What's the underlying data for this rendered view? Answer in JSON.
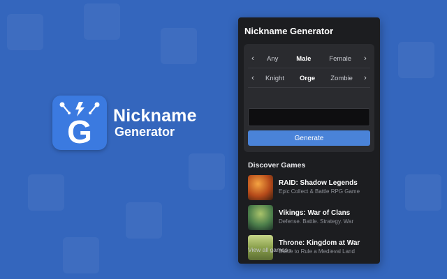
{
  "logo": {
    "line1": "Nickname",
    "line2": "Generator",
    "letter": "G",
    "icon": "lightning-g-logo-icon"
  },
  "panel": {
    "title": "Nickname Generator"
  },
  "gender_selector": {
    "prev_glyph": "‹",
    "next_glyph": "›",
    "options": [
      "Any",
      "Male",
      "Female"
    ],
    "selected": "Male"
  },
  "type_selector": {
    "prev_glyph": "‹",
    "next_glyph": "›",
    "options": [
      "Knight",
      "Orge",
      "Zombie"
    ],
    "selected": "Orge"
  },
  "nickname_input": {
    "value": ""
  },
  "generate_button": {
    "label": "Generate"
  },
  "discover": {
    "title": "Discover Games",
    "games": [
      {
        "name": "RAID: Shadow Legends",
        "description": "Epic Collect & Battle RPG Game"
      },
      {
        "name": "Vikings: War of Clans",
        "description": "Defense. Battle. Strategy. War"
      },
      {
        "name": "Throne: Kingdom at War",
        "description": "Battle to Rule a Medieval Land"
      }
    ],
    "view_all": "View all games ›"
  },
  "colors": {
    "background": "#3466bd",
    "panel": "#1c1d20",
    "card": "#2a2b2f",
    "accent": "#4a83d8",
    "logo_tile": "#3b7ae0"
  }
}
